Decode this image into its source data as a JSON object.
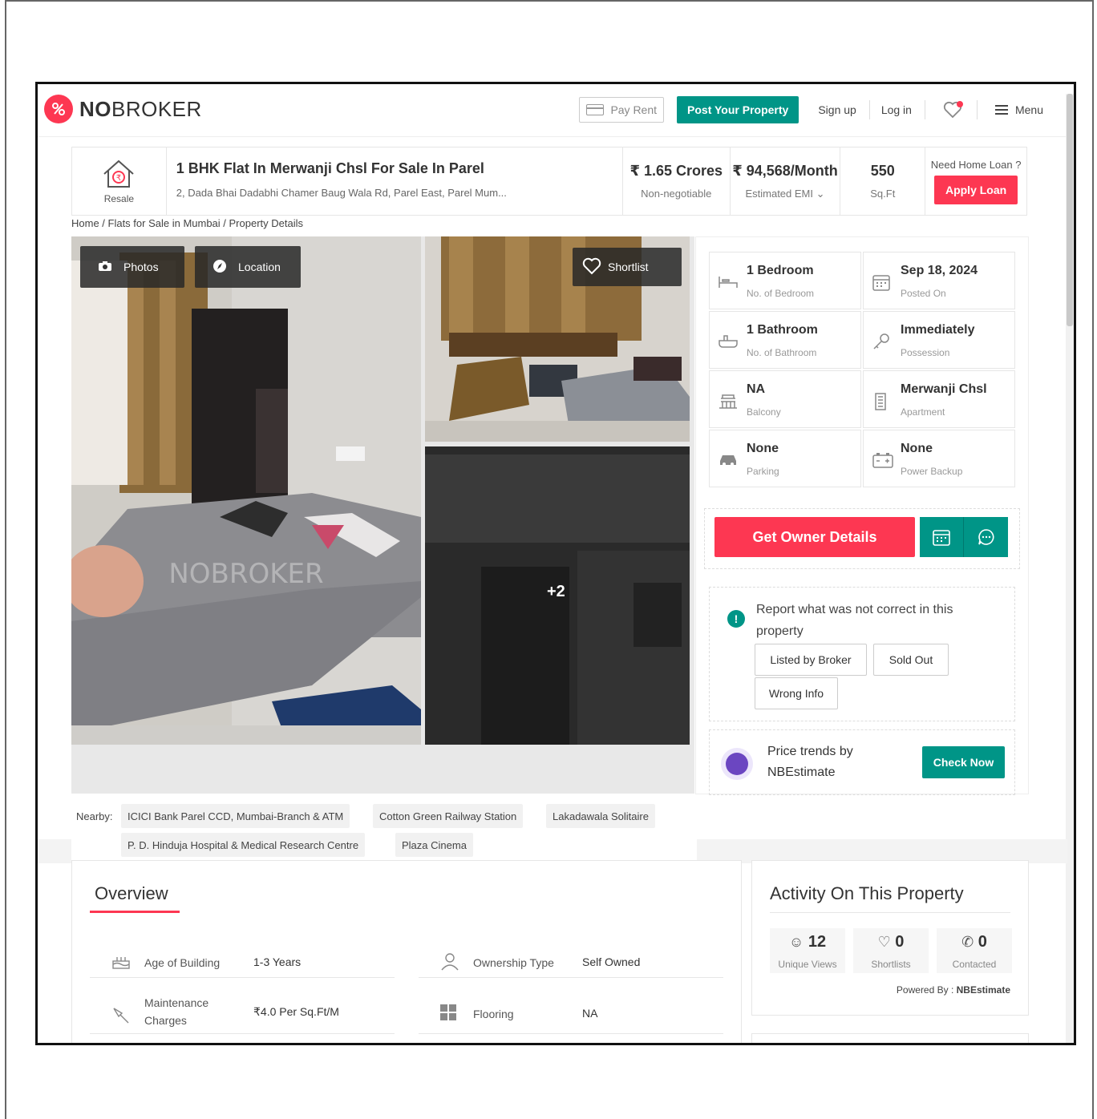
{
  "header": {
    "logo_bold": "NO",
    "logo_rest": "BROKER",
    "pay_rent": "Pay Rent",
    "post_property": "Post Your Property",
    "sign_up": "Sign up",
    "log_in": "Log in",
    "menu": "Menu"
  },
  "property": {
    "badge": "Resale",
    "title": "1 BHK Flat In Merwanji Chsl For Sale In Parel",
    "address": "2, Dada Bhai Dadabhi Chamer Baug Wala Rd, Parel East, Parel Mum...",
    "price": "₹ 1.65 Crores",
    "price_note": "Non-negotiable",
    "emi": "₹ 94,568/Month",
    "emi_note": "Estimated EMI",
    "area": "550",
    "area_unit": "Sq.Ft",
    "loan_question": "Need Home Loan ?",
    "apply_loan": "Apply Loan"
  },
  "breadcrumb": "Home / Flats for Sale in Mumbai / Property Details",
  "gallery": {
    "photos": "Photos",
    "location": "Location",
    "shortlist": "Shortlist",
    "more_count": "+2",
    "watermark": "NOBROKER"
  },
  "details": [
    {
      "value": "1 Bedroom",
      "label": "No. of Bedroom",
      "icon": "bed-icon"
    },
    {
      "value": "Sep 18, 2024",
      "label": "Posted On",
      "icon": "calendar-icon"
    },
    {
      "value": "1 Bathroom",
      "label": "No. of Bathroom",
      "icon": "bathtub-icon"
    },
    {
      "value": "Immediately",
      "label": "Possession",
      "icon": "key-icon"
    },
    {
      "value": "NA",
      "label": "Balcony",
      "icon": "balcony-icon"
    },
    {
      "value": "Merwanji Chsl",
      "label": "Apartment",
      "icon": "building-icon"
    },
    {
      "value": "None",
      "label": "Parking",
      "icon": "car-icon"
    },
    {
      "value": "None",
      "label": "Power Backup",
      "icon": "battery-icon"
    }
  ],
  "owner": {
    "get_owner": "Get Owner Details"
  },
  "report": {
    "text": "Report what was not correct in this property",
    "options": [
      "Listed by Broker",
      "Sold Out",
      "Wrong Info"
    ]
  },
  "trends": {
    "line1": "Price trends by",
    "line2": "NBEstimate",
    "check_now": "Check Now"
  },
  "nearby": {
    "label": "Nearby:",
    "places": [
      "ICICI Bank Parel CCD, Mumbai-Branch & ATM",
      "Cotton Green Railway Station",
      "Lakadawala Solitaire",
      "P. D. Hinduja Hospital & Medical Research Centre",
      "Plaza Cinema"
    ]
  },
  "overview": {
    "title": "Overview",
    "rows": [
      {
        "label": "Age of Building",
        "value": "1-3 Years"
      },
      {
        "label": "Ownership Type",
        "value": "Self Owned"
      },
      {
        "label": "Maintenance Charges",
        "value": "₹4.0 Per Sq.Ft/M"
      },
      {
        "label": "Flooring",
        "value": "NA"
      }
    ]
  },
  "activity": {
    "title": "Activity On This Property",
    "stats": [
      {
        "value": "12",
        "label": "Unique Views"
      },
      {
        "value": "0",
        "label": "Shortlists"
      },
      {
        "value": "0",
        "label": "Contacted"
      }
    ],
    "powered_by_label": "Powered By :",
    "powered_by_value": "NBEstimate"
  },
  "colors": {
    "brand_red": "#fd3752",
    "brand_teal": "#009587"
  }
}
